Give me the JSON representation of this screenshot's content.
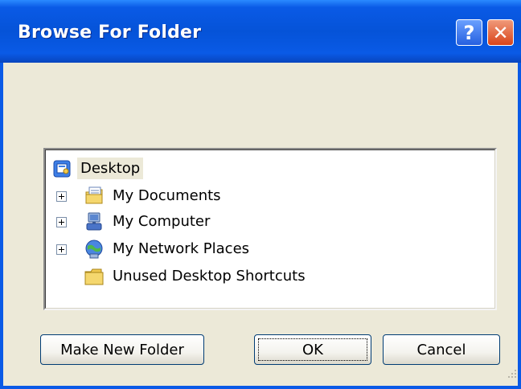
{
  "window": {
    "title": "Browse For Folder",
    "help_glyph": "?",
    "close_glyph": "✕"
  },
  "tree": {
    "root": {
      "label": "Desktop",
      "icon": "desktop-icon"
    },
    "items": [
      {
        "label": "My Documents",
        "icon": "my-documents-icon",
        "expandable": true
      },
      {
        "label": "My Computer",
        "icon": "my-computer-icon",
        "expandable": true
      },
      {
        "label": "My Network Places",
        "icon": "network-places-icon",
        "expandable": true
      },
      {
        "label": "Unused Desktop Shortcuts",
        "icon": "folder-icon",
        "expandable": false
      }
    ]
  },
  "buttons": {
    "make_new_folder": "Make New Folder",
    "ok": "OK",
    "cancel": "Cancel"
  },
  "colors": {
    "titlebar": "#0a5ae6",
    "dialog_bg": "#ece9d8",
    "button_border": "#003c74"
  }
}
